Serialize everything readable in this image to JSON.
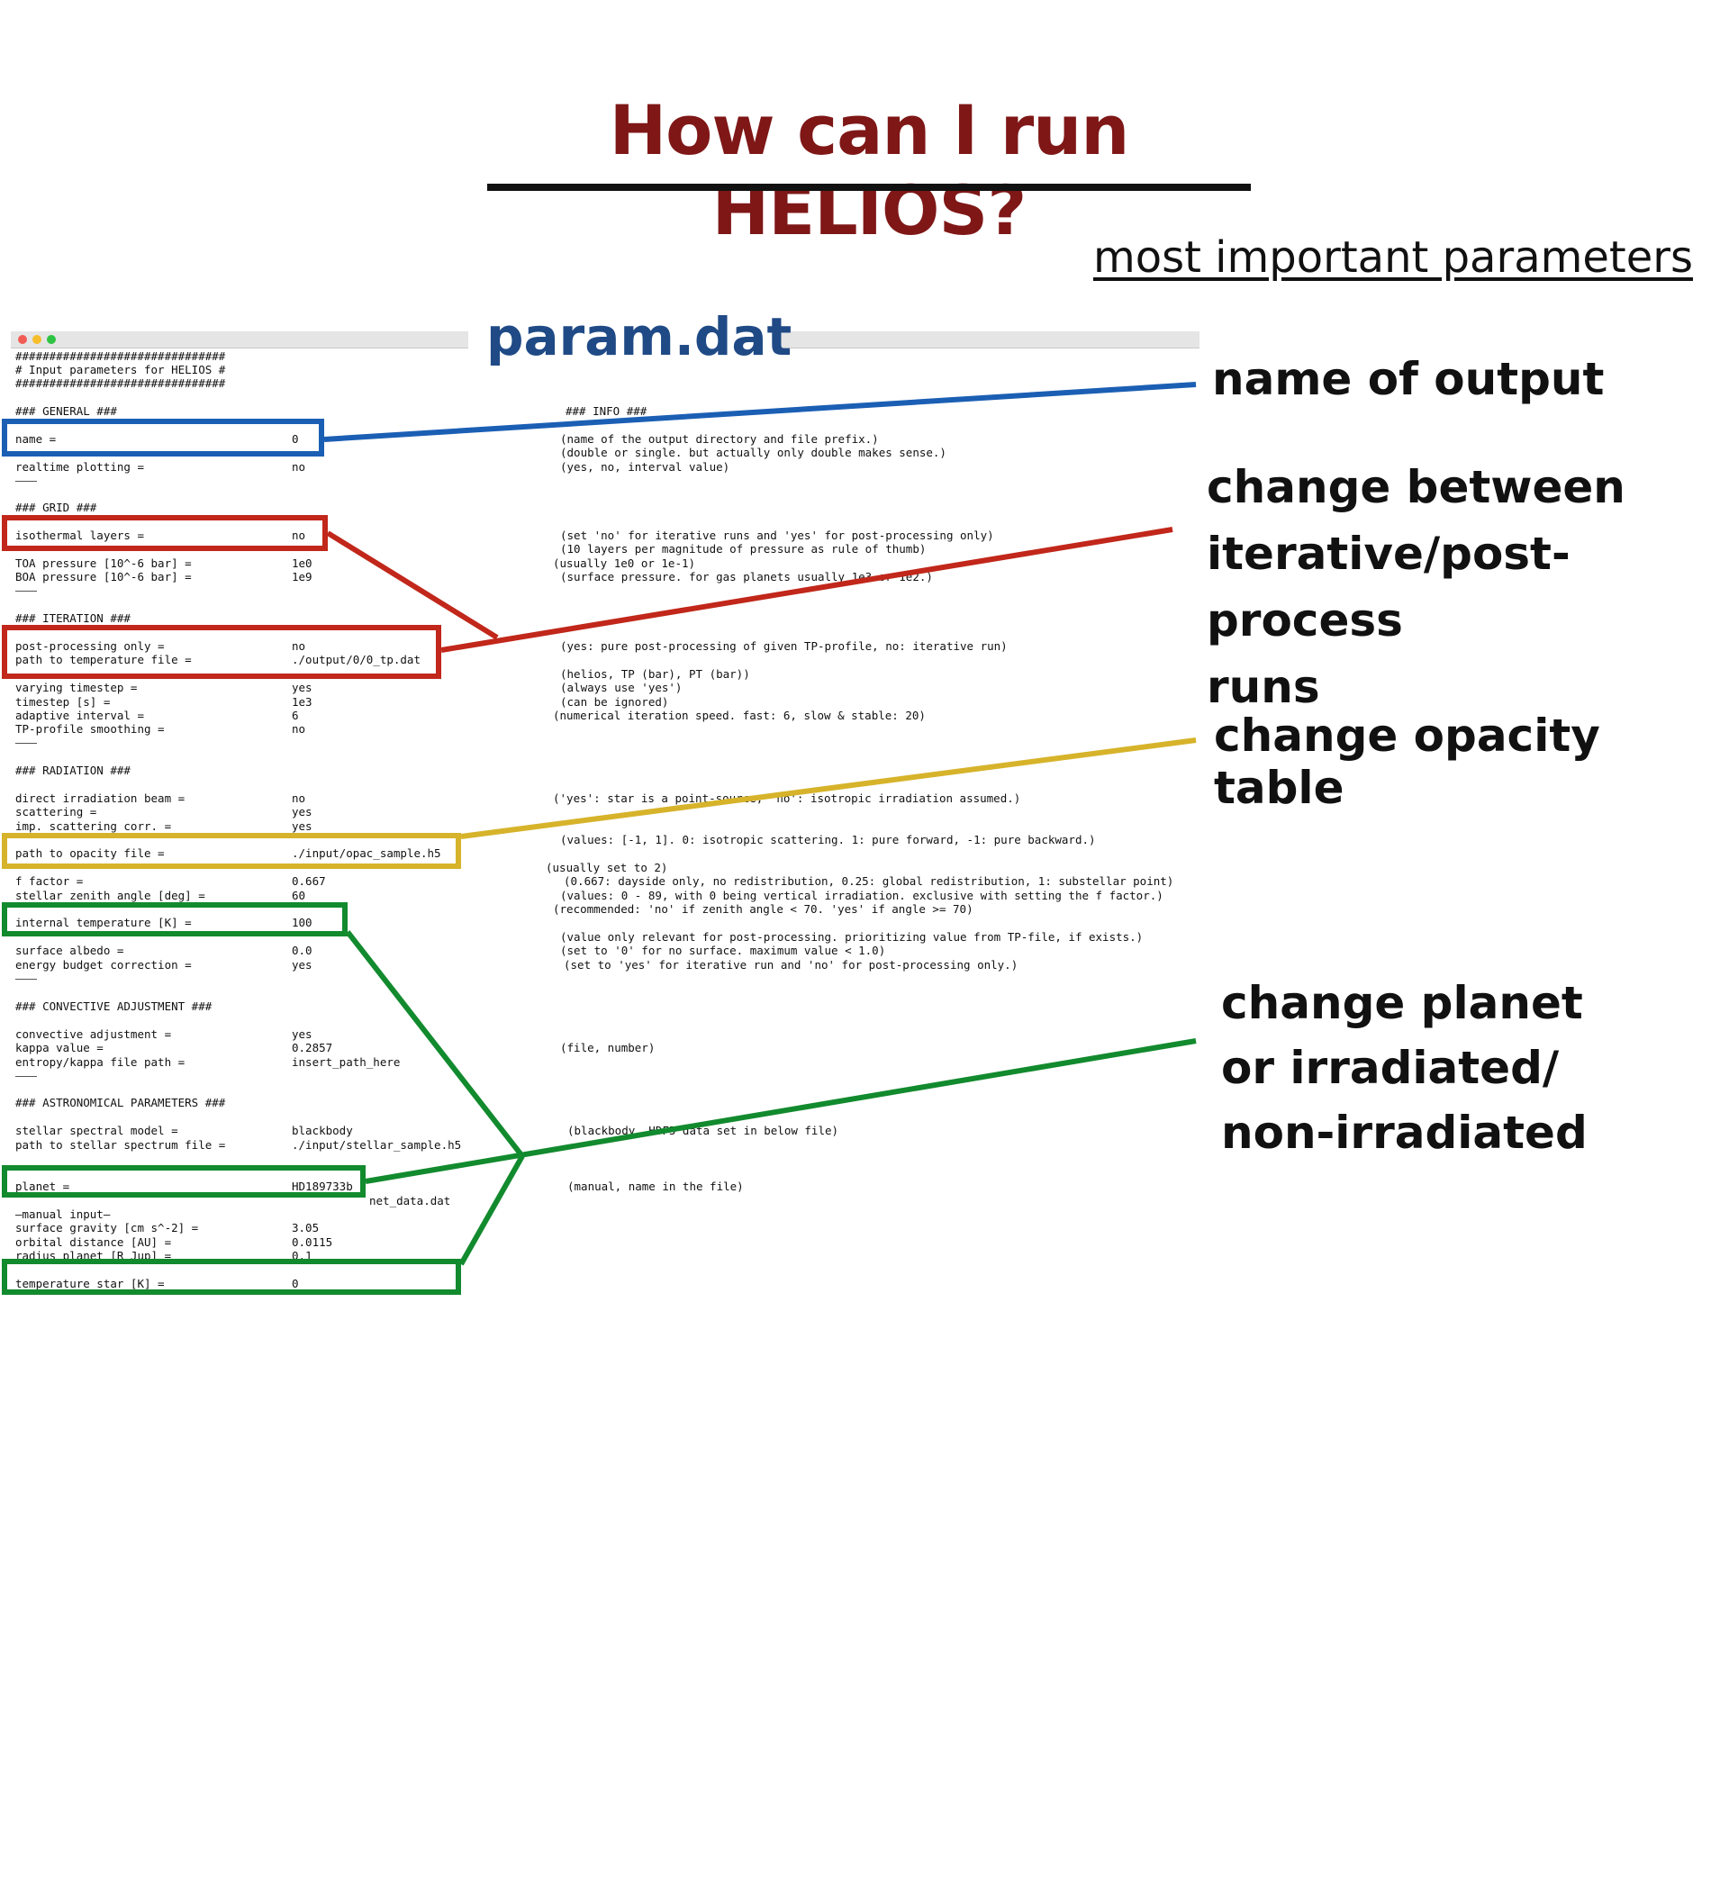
{
  "slide": {
    "title": "How can I run HELIOS?",
    "subtitle": "most important parameters",
    "file_name": "param.dat"
  },
  "header_lines": [
    "###############################",
    "# Input parameters for HELIOS #",
    "###############################"
  ],
  "sections": {
    "general": "### GENERAL ###",
    "info": "### INFO ###",
    "grid": "### GRID ###",
    "iteration": "### ITERATION ###",
    "radiation": "### RADIATION ###",
    "convective": "### CONVECTIVE ADJUSTMENT ###",
    "astro": "### ASTRONOMICAL PARAMETERS ###"
  },
  "params": {
    "name": {
      "label": "name =",
      "value": "0",
      "info": "(name of the output directory and file prefix.)"
    },
    "precision": {
      "info": "(double or single. but actually only double makes sense.)"
    },
    "realtime": {
      "label": "realtime plotting =",
      "value": "no",
      "info": "(yes, no, interval value)"
    },
    "isothermal": {
      "label": "isothermal layers =",
      "value": "no",
      "info": "(set 'no' for iterative runs and 'yes' for post-processing only)"
    },
    "nlayers": {
      "info": "(10 layers per magnitude of pressure as rule of thumb)"
    },
    "toa": {
      "label": "TOA pressure [10^-6 bar] =",
      "value": "1e0",
      "info": "(usually 1e0 or 1e-1)"
    },
    "boa": {
      "label": "BOA pressure [10^-6 bar] =",
      "value": "1e9",
      "info": "(surface pressure. for gas planets usually 1e3 or 1e2.)"
    },
    "postproc": {
      "label": "post-processing only =",
      "value": "no",
      "info": "(yes: pure post-processing of given TP-profile, no: iterative run)"
    },
    "temp_path": {
      "label": "path to temperature file =",
      "value": "./output/0/0_tp.dat"
    },
    "temp_format": {
      "info": "(helios, TP (bar), PT (bar))"
    },
    "varying": {
      "label": "varying timestep =",
      "value": "yes",
      "info": "(always use 'yes')"
    },
    "timestep": {
      "label": "timestep [s] =",
      "value": "1e3",
      "info": "(can be ignored)"
    },
    "adaptive": {
      "label": "adaptive interval =",
      "value": "6",
      "info": "(numerical iteration speed. fast: 6, slow & stable: 20)"
    },
    "smoothing": {
      "label": "TP-profile smoothing =",
      "value": "no"
    },
    "direct_beam": {
      "label": "direct irradiation beam =",
      "value": "no",
      "info": "('yes': star is a point-source, 'no': isotropic irradiation assumed.)"
    },
    "scattering": {
      "label": "scattering =",
      "value": "yes"
    },
    "imp_scat": {
      "label": "imp. scattering corr. =",
      "value": "yes"
    },
    "asym": {
      "info": "(values: [-1, 1]. 0: isotropic scattering. 1: pure forward, -1: pure backward.)"
    },
    "opacity": {
      "label": "path to opacity file =",
      "value": "./input/opac_sample.h5"
    },
    "diffusivity": {
      "info": "(usually set to 2)"
    },
    "f_factor": {
      "label": "f factor =",
      "value": "0.667",
      "info": "(0.667: dayside only, no redistribution, 0.25: global redistribution, 1: substellar point)"
    },
    "zenith": {
      "label": "stellar zenith angle [deg] =",
      "value": "60",
      "info": "(values: 0 - 89, with 0 being vertical irradiation. exclusive with setting the f factor.)"
    },
    "geom_zenith": {
      "info": "(recommended: 'no' if zenith angle < 70. 'yes' if angle >= 70)"
    },
    "internal_temp": {
      "label": "internal temperature [K] =",
      "value": "100",
      "info": "(value only relevant for post-processing. prioritizing value from TP-file, if exists.)"
    },
    "albedo": {
      "label": "surface albedo =",
      "value": "0.0",
      "info": "(set to '0' for no surface. maximum value < 1.0)"
    },
    "energy_budget": {
      "label": "energy budget correction =",
      "value": "yes",
      "info": "(set to 'yes' for iterative run and 'no' for post-processing only.)"
    },
    "convective": {
      "label": "convective adjustment =",
      "value": "yes"
    },
    "kappa": {
      "label": "kappa value =",
      "value": "0.2857",
      "info": "(file, number)"
    },
    "entropy": {
      "label": "entropy/kappa file path =",
      "value": "insert_path_here"
    },
    "spectral_model": {
      "label": "stellar spectral model =",
      "value": "blackbody",
      "info": "(blackbody, HDF5 data set in below file)"
    },
    "spectrum_path": {
      "label": "path to stellar spectrum file =",
      "value": "./input/stellar_sample.h5"
    },
    "planet": {
      "label": "planet =",
      "value": "HD189733b",
      "info": "(manual, name in the file)"
    },
    "planet_data": {
      "value": "net_data.dat"
    },
    "manual": {
      "label": "—manual input—"
    },
    "gravity": {
      "label": "surface gravity [cm s^-2] =",
      "value": "3.05"
    },
    "orbit": {
      "label": "orbital distance [AU] =",
      "value": "0.0115"
    },
    "radius": {
      "label": "radius planet [R_Jup] =",
      "value": "0.1"
    },
    "temp_star": {
      "label": "temperature star [K] =",
      "value": "0"
    }
  },
  "callouts": {
    "output": "name of output",
    "iterative": [
      "change between",
      "iterative/post-process",
      "runs"
    ],
    "opacity": "change opacity table",
    "planet": [
      "change planet",
      "or irradiated/",
      "non-irradiated"
    ]
  },
  "colors": {
    "blue": "#1b5fb4",
    "red": "#c1271a",
    "yellow": "#d6b32a",
    "green": "#128a2e",
    "title": "#7f1717"
  }
}
